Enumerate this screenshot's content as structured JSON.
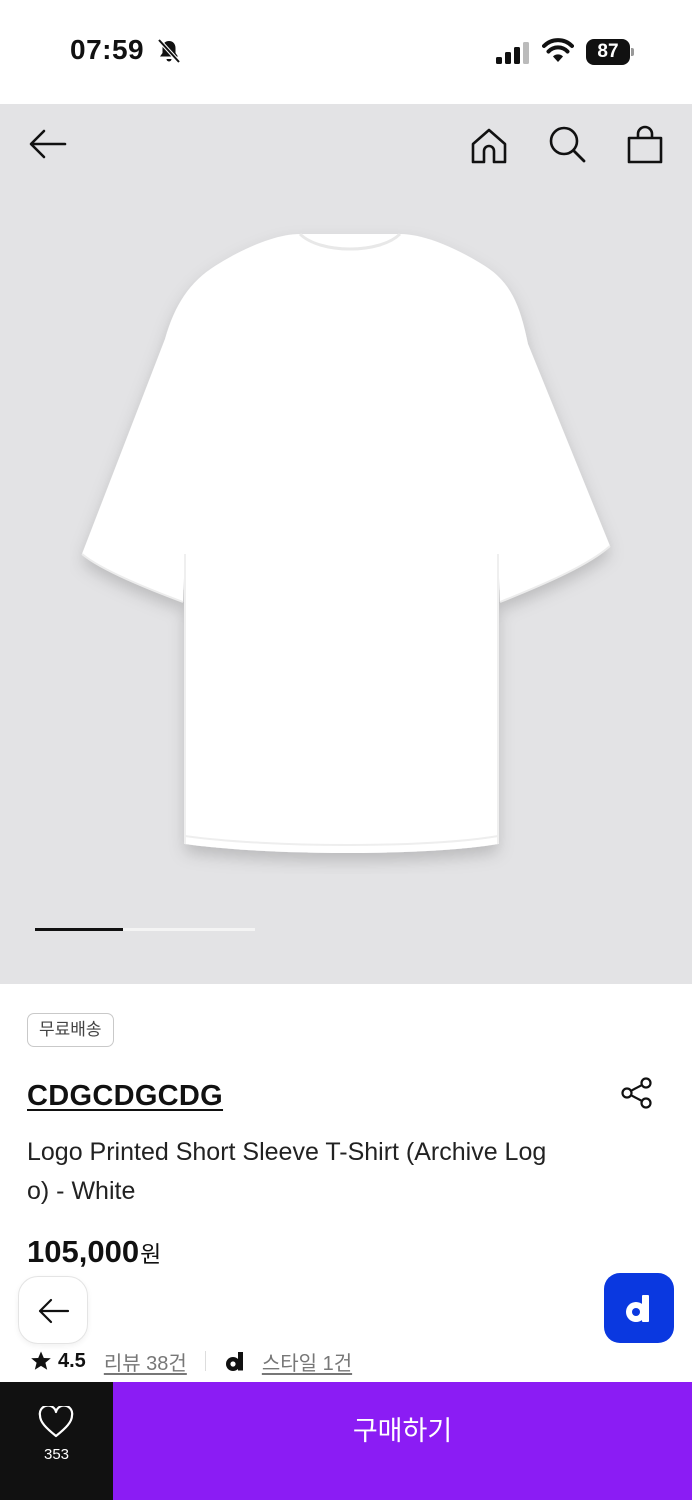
{
  "status_bar": {
    "time": "07:59",
    "battery": "87"
  },
  "nav": {
    "back_icon": "arrow-left-icon",
    "home_icon": "home-icon",
    "search_icon": "search-icon",
    "bag_icon": "shopping-bag-icon"
  },
  "gallery": {
    "progress": 0.4
  },
  "product": {
    "badge": "무료배송",
    "brand": "CDGCDGCDG",
    "title": "Logo Printed Short Sleeve T-Shirt (Archive Logo) - White",
    "price": "105,000",
    "currency": "원",
    "rating": "4.5",
    "reviews": "리뷰 38건",
    "styles": "스타일 1건"
  },
  "bottom_bar": {
    "likes": "353",
    "buy_label": "구매하기"
  },
  "colors": {
    "accent": "#8b1cf4",
    "floating_brand": "#0a38e0",
    "image_bg": "#e3e3e5"
  }
}
